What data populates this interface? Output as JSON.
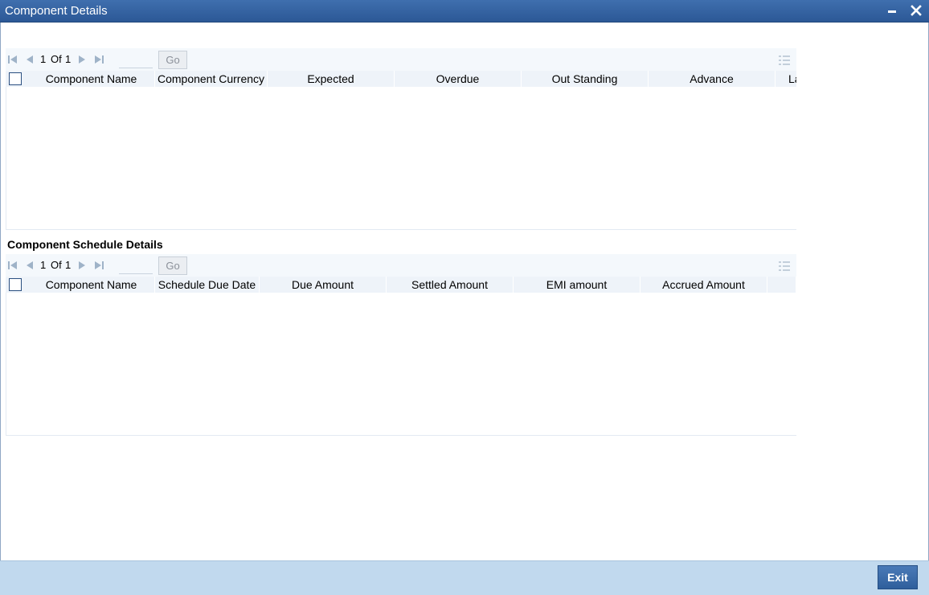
{
  "window": {
    "title": "Component Details",
    "minimize_icon": "minimize-icon",
    "close_icon": "close-icon"
  },
  "component_grid": {
    "pager": {
      "current": "1",
      "of_label": "Of",
      "total": "1",
      "page_input": "",
      "go_label": "Go"
    },
    "columns": [
      "Component Name",
      "Component Currency",
      "Expected",
      "Overdue",
      "Out Standing",
      "Advance",
      "La"
    ],
    "rows": []
  },
  "schedule_section": {
    "title": "Component Schedule Details"
  },
  "schedule_grid": {
    "pager": {
      "current": "1",
      "of_label": "Of",
      "total": "1",
      "page_input": "",
      "go_label": "Go"
    },
    "columns": [
      "Component Name",
      "Schedule Due Date",
      "Due Amount",
      "Settled Amount",
      "EMI amount",
      "Accrued Amount",
      ""
    ],
    "rows": []
  },
  "footer": {
    "exit_label": "Exit"
  },
  "colors": {
    "titlebar": "#2c5896",
    "footer": "#c1d9ee",
    "header_row": "#eef3f9",
    "toolbar": "#f4f8fc"
  }
}
